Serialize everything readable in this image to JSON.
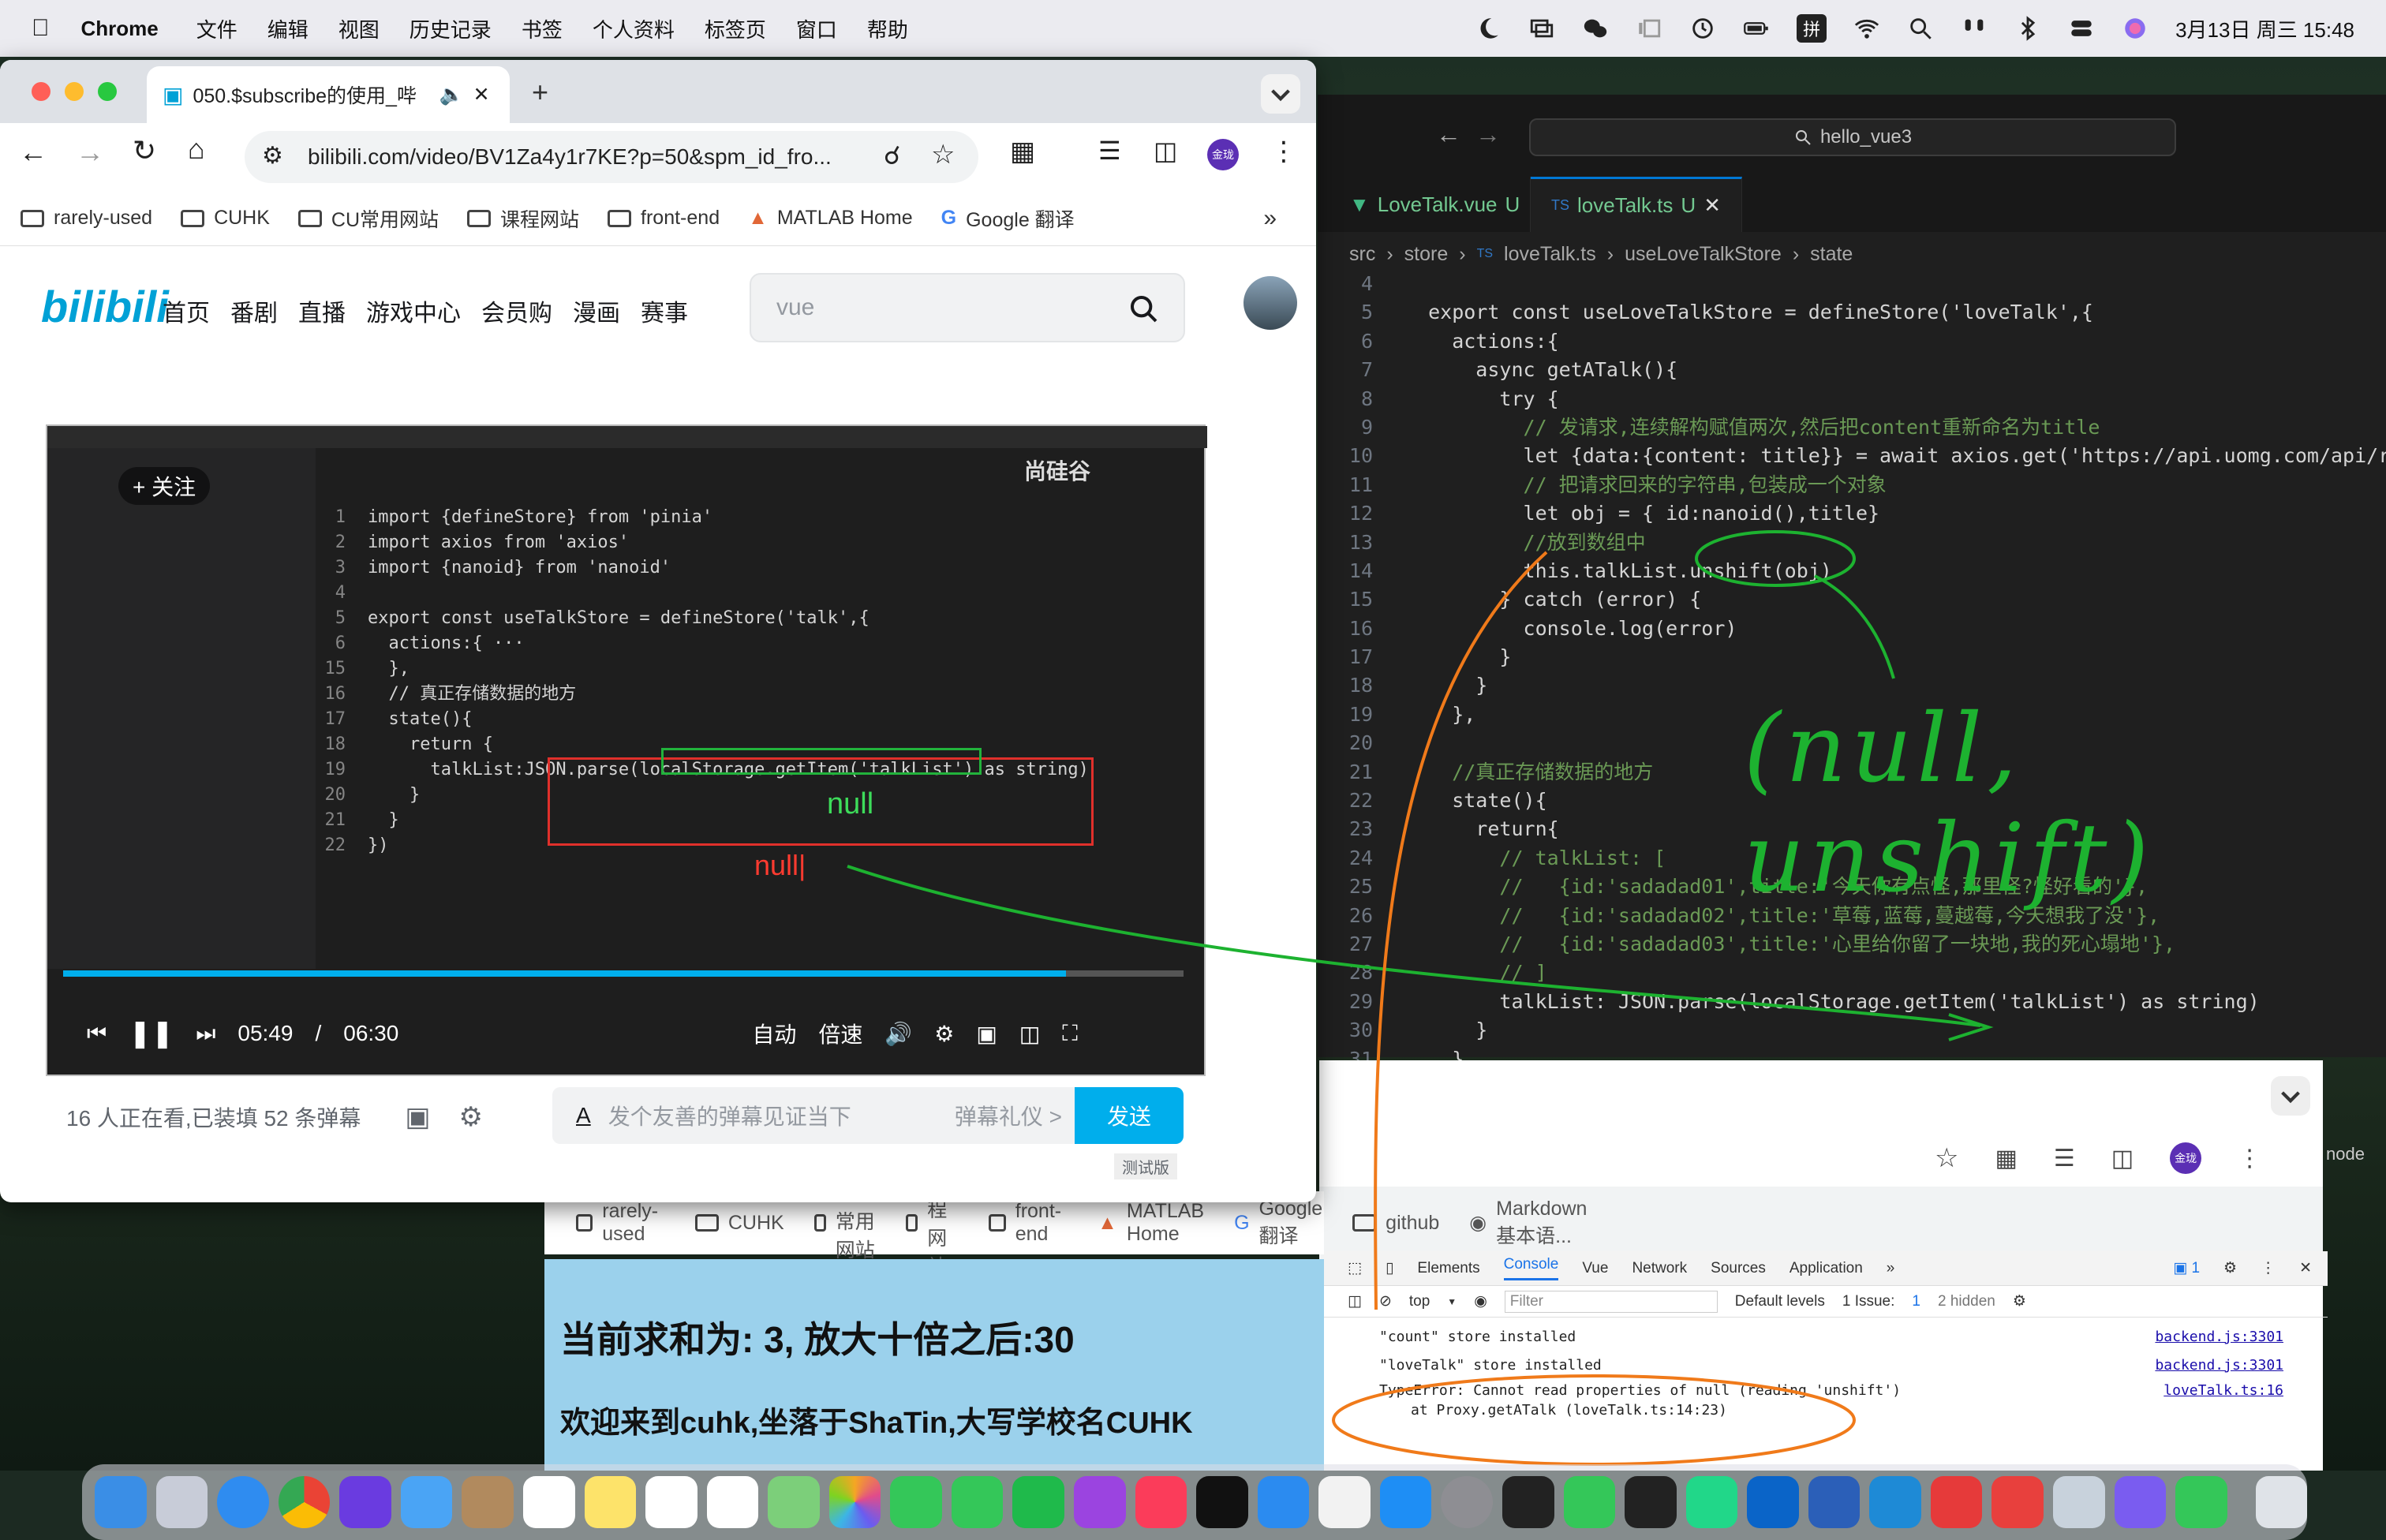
{
  "menubar": {
    "app": "Chrome",
    "items": [
      "文件",
      "编辑",
      "视图",
      "历史记录",
      "书签",
      "个人资料",
      "标签页",
      "窗口",
      "帮助"
    ],
    "input_method": "拼",
    "datetime": "3月13日 周三  15:48"
  },
  "vscode": {
    "search": "hello_vue3",
    "tabs": [
      {
        "label": "LoveTalk.vue",
        "badge": "U"
      },
      {
        "label": "loveTalk.ts",
        "badge": "U"
      }
    ],
    "breadcrumb": [
      "src",
      "store",
      "loveTalk.ts",
      "useLoveTalkStore",
      "state"
    ],
    "lines": [
      {
        "n": "4",
        "t": ""
      },
      {
        "n": "5",
        "t": "  export const useLoveTalkStore = defineStore('loveTalk',{"
      },
      {
        "n": "6",
        "t": "    actions:{"
      },
      {
        "n": "7",
        "t": "      async getATalk(){"
      },
      {
        "n": "8",
        "t": "        try {"
      },
      {
        "n": "9",
        "t": "          // 发请求,连续解构赋值两次,然后把content重新命名为title"
      },
      {
        "n": "10",
        "t": "          let {data:{content: title}} = await axios.get('https://api.uomg.com/api/rand"
      },
      {
        "n": "11",
        "t": "          // 把请求回来的字符串,包装成一个对象"
      },
      {
        "n": "12",
        "t": "          let obj = { id:nanoid(),title}"
      },
      {
        "n": "13",
        "t": "          //放到数组中"
      },
      {
        "n": "14",
        "t": "          this.talkList.unshift(obj)"
      },
      {
        "n": "15",
        "t": "        } catch (error) {"
      },
      {
        "n": "16",
        "t": "          console.log(error)"
      },
      {
        "n": "17",
        "t": "        }"
      },
      {
        "n": "18",
        "t": "      }"
      },
      {
        "n": "19",
        "t": "    },"
      },
      {
        "n": "20",
        "t": ""
      },
      {
        "n": "21",
        "t": "    //真正存储数据的地方"
      },
      {
        "n": "22",
        "t": "    state(){"
      },
      {
        "n": "23",
        "t": "      return{"
      },
      {
        "n": "24",
        "t": "        // talkList: ["
      },
      {
        "n": "25",
        "t": "        //   {id:'sadadad01',title:'今天你有点怪,那里怪?怪好看的'},"
      },
      {
        "n": "26",
        "t": "        //   {id:'sadadad02',title:'草莓,蓝莓,蔓越莓,今天想我了没'},"
      },
      {
        "n": "27",
        "t": "        //   {id:'sadadad03',title:'心里给你留了一块地,我的死心塌地'},"
      },
      {
        "n": "28",
        "t": "        // ]"
      },
      {
        "n": "29",
        "t": "        talkList: JSON.parse(localStorage.getItem('talkList') as string)"
      },
      {
        "n": "30",
        "t": "      }"
      },
      {
        "n": "31",
        "t": "    }"
      }
    ],
    "annotation": "(null, unshift)",
    "terminal_label": "node"
  },
  "chrome_bottom": {
    "bookmarks": [
      "rarely-used",
      "CUHK",
      "CU常用网站",
      "课程网站",
      "front-end",
      "MATLAB Home",
      "Google 翻译",
      "github",
      "Markdown 基本语..."
    ],
    "devtools_tabs": [
      "Elements",
      "Console",
      "Vue",
      "Network",
      "Sources",
      "Application"
    ],
    "filter": {
      "context": "top",
      "placeholder": "Filter",
      "levels": "Default levels",
      "issues": "1 Issue:",
      "issue_count": "1",
      "hidden": "2 hidden"
    },
    "messages": [
      {
        "text": "\"count\" store installed",
        "src": "backend.js:3301"
      },
      {
        "text": "\"loveTalk\" store installed",
        "src": "backend.js:3301"
      },
      {
        "text": "TypeError: Cannot read properties of null (reading 'unshift')",
        "sub": "at Proxy.getATalk (loveTalk.ts:14:23)",
        "src": "loveTalk.ts:16"
      }
    ],
    "page_heading": "当前求和为: 3, 放大十倍之后:30",
    "page_text": "欢迎来到cuhk,坐落于ShaTin,大写学校名CUHK"
  },
  "chrome_top": {
    "tab_title": "050.$subscribe的使用_哔",
    "url": "bilibili.com/video/BV1Za4y1r7KE?p=50&spm_id_fro...",
    "bookmarks": [
      "rarely-used",
      "CUHK",
      "CU常用网站",
      "课程网站",
      "front-end",
      "MATLAB Home",
      "Google 翻译"
    ],
    "profile": "金珑"
  },
  "bilibili": {
    "logo": "bilibili",
    "nav": [
      "首页",
      "番剧",
      "直播",
      "游戏中心",
      "会员购",
      "漫画",
      "赛事"
    ],
    "search_value": "vue",
    "video": {
      "follow": "+ 关注",
      "watermark": "尚硅谷",
      "code_lines": [
        {
          "n": "1",
          "t": "import {defineStore} from 'pinia'"
        },
        {
          "n": "2",
          "t": "import axios from 'axios'"
        },
        {
          "n": "3",
          "t": "import {nanoid} from 'nanoid'"
        },
        {
          "n": "4",
          "t": ""
        },
        {
          "n": "5",
          "t": "export const useTalkStore = defineStore('talk',{"
        },
        {
          "n": "6",
          "t": "  actions:{ ···"
        },
        {
          "n": "15",
          "t": "  },"
        },
        {
          "n": "16",
          "t": "  // 真正存储数据的地方"
        },
        {
          "n": "17",
          "t": "  state(){"
        },
        {
          "n": "18",
          "t": "    return {"
        },
        {
          "n": "19",
          "t": "      talkList:JSON.parse(localStorage.getItem('talkList') as string)"
        },
        {
          "n": "20",
          "t": "    }"
        },
        {
          "n": "21",
          "t": "  }"
        },
        {
          "n": "22",
          "t": "})"
        }
      ],
      "null_label": "null",
      "null_red": "null|",
      "time_current": "05:49",
      "time_sep": "/",
      "time_total": "06:30",
      "auto": "自动",
      "speed": "倍速"
    },
    "viewers": "16 人正在看,已装填 52 条弹幕",
    "danmu_placeholder": "发个友善的弹幕见证当下",
    "danmu_etiquette": "弹幕礼仪 >",
    "send": "发送",
    "beta": "测试版"
  },
  "colors": {
    "accent": "#00aeec",
    "vscode_bg": "#1f1f1f",
    "annotation_green": "#1db230",
    "annotation_orange": "#f07a1a"
  }
}
